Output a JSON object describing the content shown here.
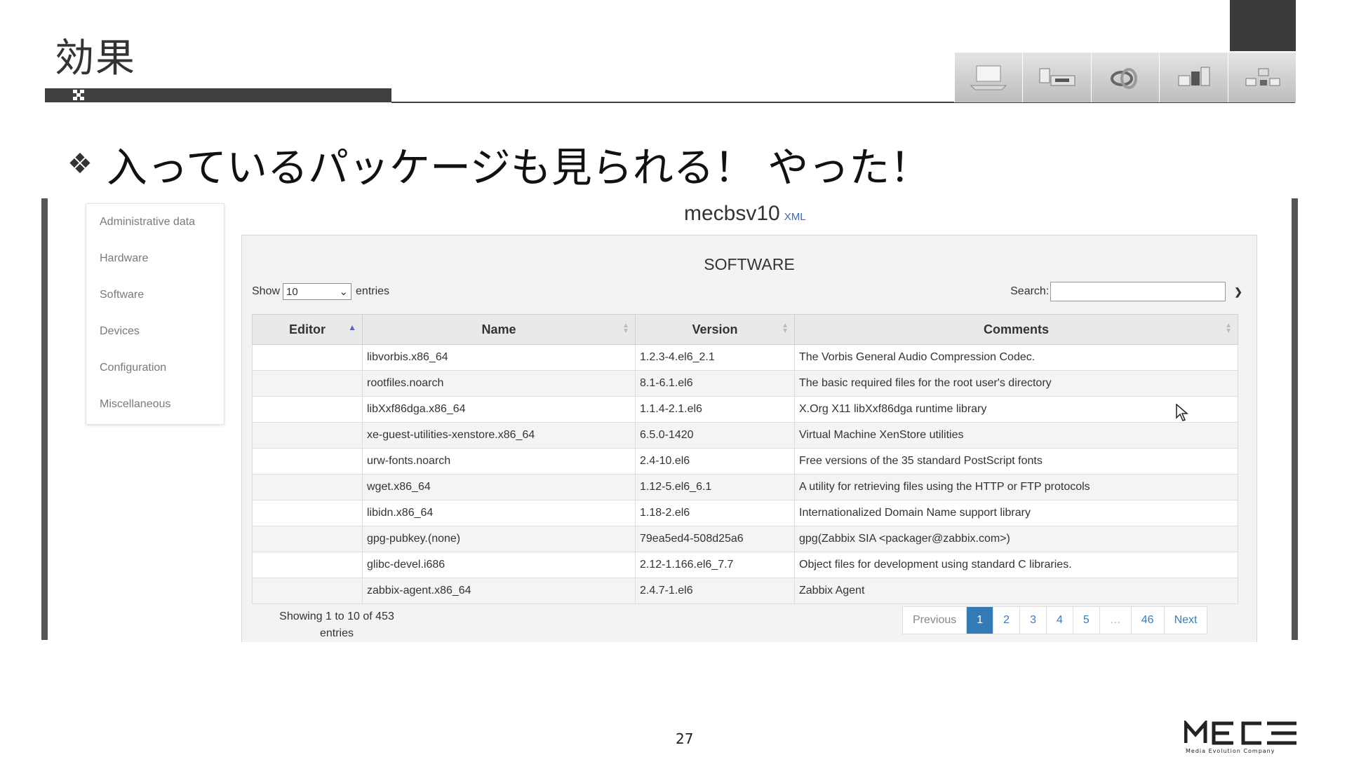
{
  "slide": {
    "title": "効果",
    "bullet_mark": "❖",
    "bullet_text": "入っているパッケージも見られる！ やった！",
    "page_number": "27",
    "logo_text": "MEC",
    "logo_tagline": "Media Evolution Company"
  },
  "icon_strip": [
    "laptop-icon",
    "server-blocks-icon",
    "knot-icon",
    "cubes-icon",
    "network-blocks-icon"
  ],
  "sidebar": {
    "items": [
      {
        "label": "Administrative data"
      },
      {
        "label": "Hardware"
      },
      {
        "label": "Software"
      },
      {
        "label": "Devices"
      },
      {
        "label": "Configuration"
      },
      {
        "label": "Miscellaneous"
      }
    ]
  },
  "header": {
    "hostname": "mecbsv10",
    "xml_link": "XML"
  },
  "panel": {
    "title": "SOFTWARE",
    "show_label": "Show",
    "show_value": "10",
    "entries_label": "entries",
    "search_label": "Search:",
    "search_value": ""
  },
  "table": {
    "columns": [
      "Editor",
      "Name",
      "Version",
      "Comments"
    ],
    "rows": [
      {
        "editor": "",
        "name": "libvorbis.x86_64",
        "version": "1.2.3-4.el6_2.1",
        "comments": "The Vorbis General Audio Compression Codec."
      },
      {
        "editor": "",
        "name": "rootfiles.noarch",
        "version": "8.1-6.1.el6",
        "comments": "The basic required files for the root user's directory"
      },
      {
        "editor": "",
        "name": "libXxf86dga.x86_64",
        "version": "1.1.4-2.1.el6",
        "comments": "X.Org X11 libXxf86dga runtime library"
      },
      {
        "editor": "",
        "name": "xe-guest-utilities-xenstore.x86_64",
        "version": "6.5.0-1420",
        "comments": "Virtual Machine XenStore utilities"
      },
      {
        "editor": "",
        "name": "urw-fonts.noarch",
        "version": "2.4-10.el6",
        "comments": "Free versions of the 35 standard PostScript fonts"
      },
      {
        "editor": "",
        "name": "wget.x86_64",
        "version": "1.12-5.el6_6.1",
        "comments": "A utility for retrieving files using the HTTP or FTP protocols"
      },
      {
        "editor": "",
        "name": "libidn.x86_64",
        "version": "1.18-2.el6",
        "comments": "Internationalized Domain Name support library"
      },
      {
        "editor": "",
        "name": "gpg-pubkey.(none)",
        "version": "79ea5ed4-508d25a6",
        "comments": "gpg(Zabbix SIA <packager@zabbix.com>)"
      },
      {
        "editor": "",
        "name": "glibc-devel.i686",
        "version": "2.12-1.166.el6_7.7",
        "comments": "Object files for development using standard C libraries."
      },
      {
        "editor": "",
        "name": "zabbix-agent.x86_64",
        "version": "2.4.7-1.el6",
        "comments": "Zabbix Agent"
      }
    ]
  },
  "footer": {
    "info_line1": "Showing 1 to 10 of 453",
    "info_line2": "entries",
    "pager": [
      "Previous",
      "1",
      "2",
      "3",
      "4",
      "5",
      "…",
      "46",
      "Next"
    ],
    "active_page": "1"
  },
  "colors": {
    "accent": "#337ab7",
    "dark_bar": "#404040",
    "link": "#3b6cb7"
  }
}
